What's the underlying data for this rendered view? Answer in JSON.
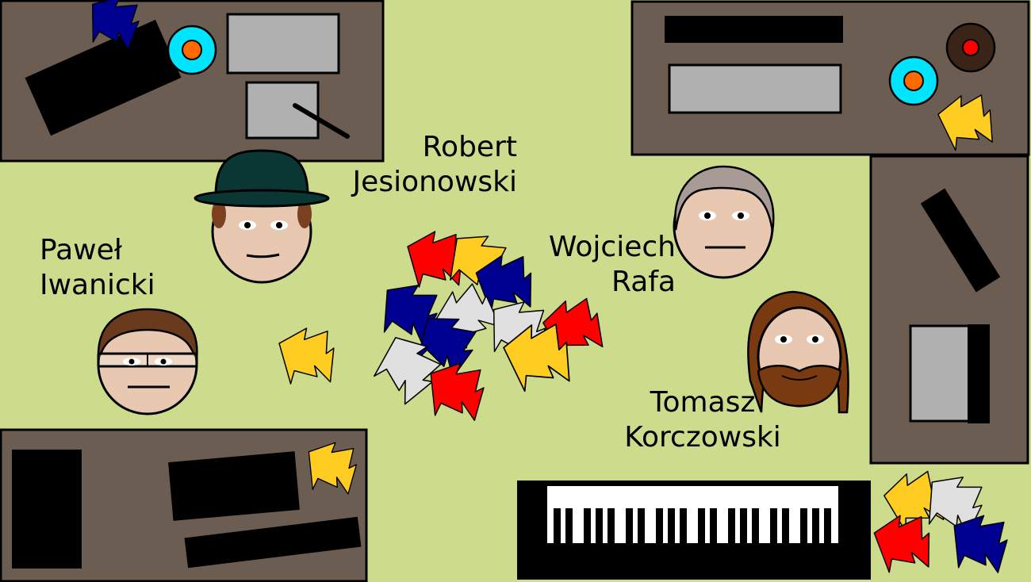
{
  "scene": {
    "background": "#cddc8c",
    "desk_color": "#6b5d52",
    "musicians": [
      {
        "id": "robert",
        "first": "Robert",
        "last": "Jesionowski"
      },
      {
        "id": "pawel",
        "first": "Paweł",
        "last": "Iwanicki"
      },
      {
        "id": "wojciech",
        "first": "Wojciech",
        "last": "Rafa"
      },
      {
        "id": "tomasz",
        "first": "Tomasz",
        "last": "Korczowski"
      }
    ],
    "leaf_colors": {
      "red": "#ff0000",
      "yellow": "#ffcc22",
      "blue": "#000090",
      "white": "#e0e0e0"
    }
  }
}
